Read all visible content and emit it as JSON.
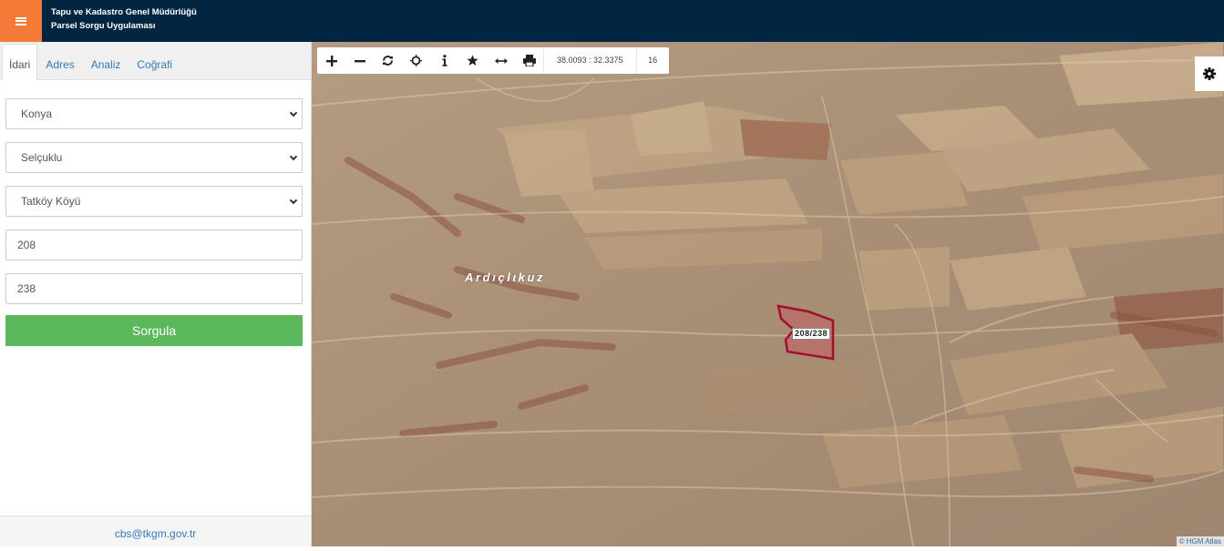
{
  "header": {
    "title_line1": "Tapu ve Kadastro Genel Müdürlüğü",
    "title_line2": "Parsel Sorgu Uygulaması",
    "menu_icon": "hamburger-icon",
    "colors": {
      "background": "#022642",
      "menu_button": "#f47a37"
    }
  },
  "sidebar": {
    "tabs": [
      {
        "label": "İdari",
        "active": true
      },
      {
        "label": "Adres",
        "active": false
      },
      {
        "label": "Analiz",
        "active": false
      },
      {
        "label": "Coğrafi",
        "active": false
      }
    ],
    "province": "Konya",
    "district": "Selçuklu",
    "neighborhood": "Tatköy Köyü",
    "block_no": "208",
    "parcel_no": "238",
    "submit_label": "Sorgula",
    "submit_color": "#5cb85c",
    "footer_email": "cbs@tkgm.gov.tr"
  },
  "map": {
    "toolbar": {
      "tools": [
        "zoom-in-icon",
        "zoom-out-icon",
        "refresh-icon",
        "locate-icon",
        "info-icon",
        "star-icon",
        "measure-icon",
        "print-icon"
      ],
      "coordinates": "38.0093 : 32.3375",
      "zoom_level": "16"
    },
    "settings_icon": "gear-icon",
    "place_label": "Ardıçlıkuz",
    "parcel_label": "208/238",
    "parcel_color": "#a0112d",
    "attribution": "© HGM Atlas"
  }
}
